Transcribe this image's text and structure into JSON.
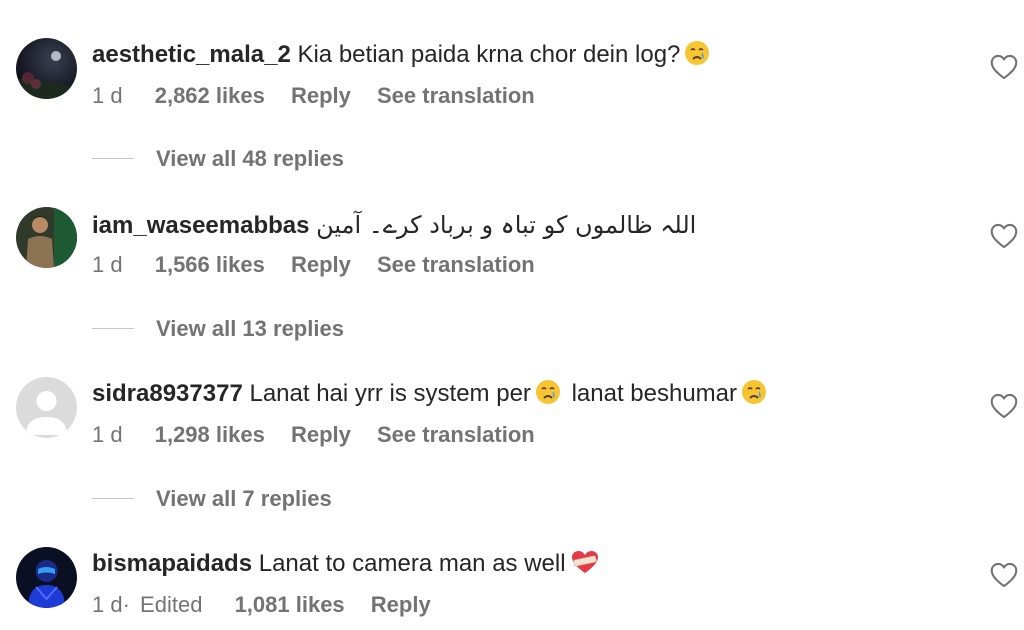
{
  "colors": {
    "text_primary": "#262626",
    "text_secondary": "#737373",
    "divider": "#c7c7c7"
  },
  "comments": [
    {
      "username": "aesthetic_mala_2",
      "text": "Kia betian paida krna chor dein log?",
      "emoji_after_text": "crying-face-emoji",
      "time": "1 d",
      "likes": "2,862 likes",
      "reply_label": "Reply",
      "translation_label": "See translation",
      "view_replies": "View all 48 replies",
      "avatar": "night-sky-avatar"
    },
    {
      "username": "iam_waseemabbas",
      "text": "اللہ ظالموں کو تباہ و برباد کرے۔ آمین",
      "time": "1 d",
      "likes": "1,566 likes",
      "reply_label": "Reply",
      "translation_label": "See translation",
      "view_replies": "View all 13 replies",
      "avatar": "man-with-flag-avatar"
    },
    {
      "username": "sidra8937377",
      "text_part1": "Lanat hai yrr is system per",
      "text_part2": "lanat beshumar",
      "emoji_after_text": "crying-face-emoji",
      "time": "1 d",
      "likes": "1,298 likes",
      "reply_label": "Reply",
      "translation_label": "See translation",
      "view_replies": "View all 7 replies",
      "avatar": "default-user-avatar"
    },
    {
      "username": "bismapaidads",
      "text": "Lanat to camera man as well",
      "emoji_after_text": "bandaged-heart-emoji",
      "time": "1 d·",
      "edited": "Edited",
      "likes": "1,081 likes",
      "reply_label": "Reply",
      "avatar": "hooded-figure-avatar"
    }
  ],
  "icons": {
    "like": "heart-outline-icon"
  }
}
